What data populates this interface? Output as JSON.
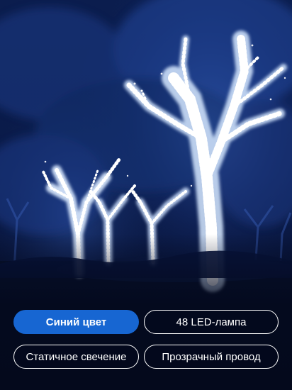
{
  "image": {
    "icon": "blue-led-string-lights-on-trees-night-photo"
  },
  "options": {
    "items": [
      {
        "label": "Синий цвет",
        "selected": true
      },
      {
        "label": "48 LED-лампа",
        "selected": false
      },
      {
        "label": "Статичное свечение",
        "selected": false
      },
      {
        "label": "Прозрачный провод",
        "selected": false
      }
    ]
  },
  "colors": {
    "accent": "#1766d2",
    "chip_border": "#ffffff",
    "chip_text": "#ffffff",
    "background": "#04091c",
    "led_glow": "#cfe8ff"
  }
}
